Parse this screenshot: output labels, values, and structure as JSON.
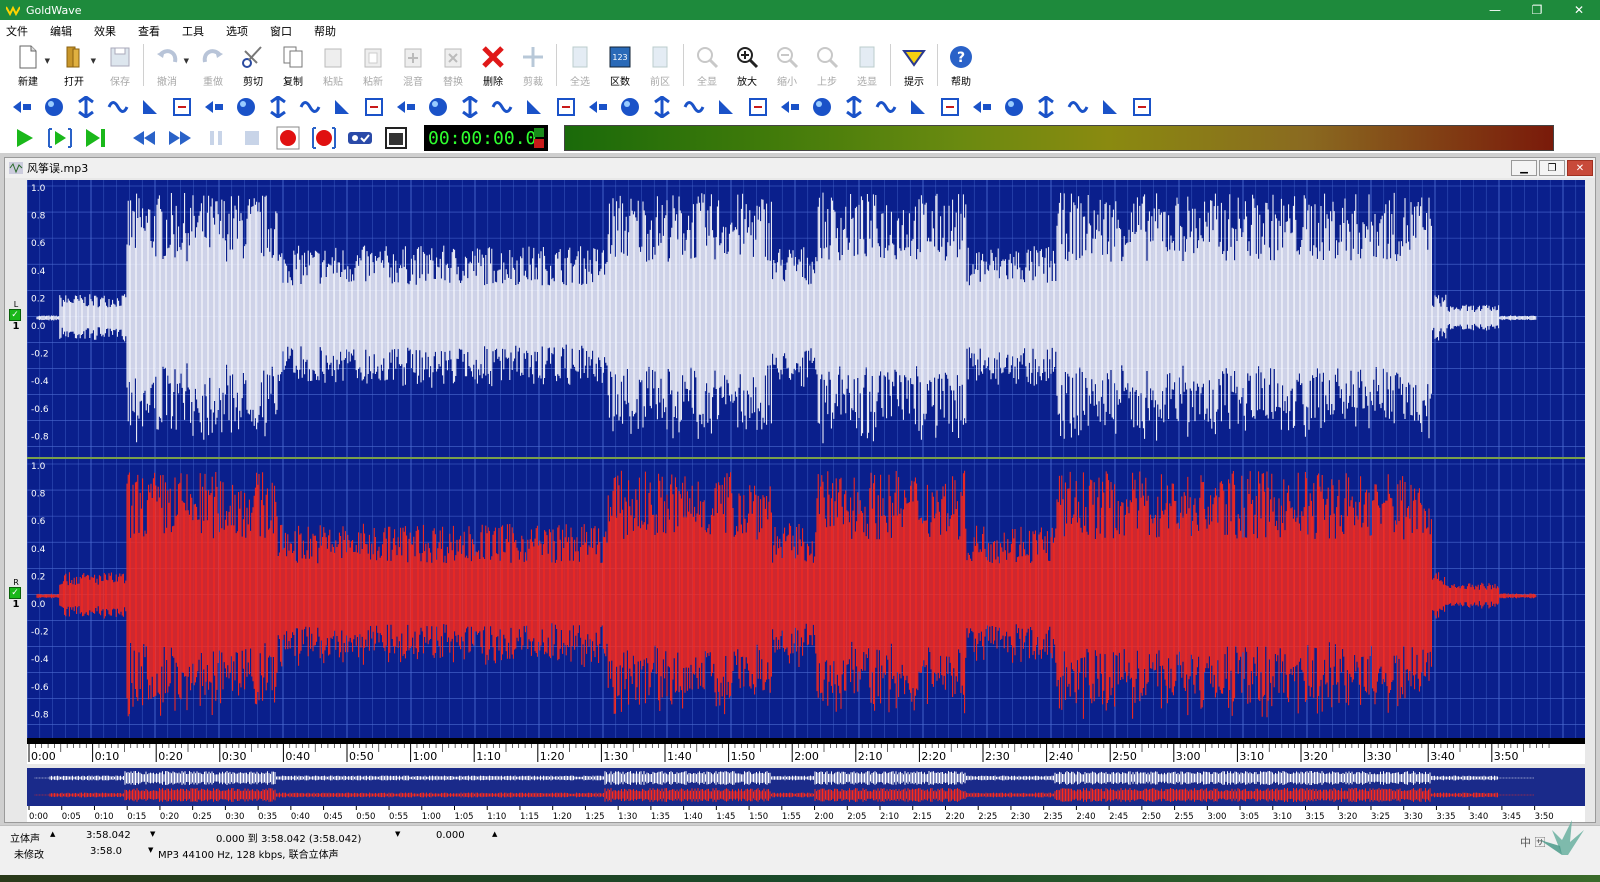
{
  "app": {
    "title": "GoldWave",
    "window_controls": {
      "minimize": "—",
      "maximize": "❐",
      "close": "✕"
    }
  },
  "menu": [
    "文件",
    "编辑",
    "效果",
    "查看",
    "工具",
    "选项",
    "窗口",
    "帮助"
  ],
  "toolbar": [
    {
      "label": "新建",
      "icon": "new-file-icon",
      "dropdown": true,
      "enabled": true
    },
    {
      "label": "打开",
      "icon": "open-icon",
      "dropdown": true,
      "enabled": true
    },
    {
      "label": "保存",
      "icon": "save-icon",
      "enabled": false
    },
    {
      "label": "撤消",
      "icon": "undo-icon",
      "dropdown": true,
      "enabled": false
    },
    {
      "label": "重做",
      "icon": "redo-icon",
      "enabled": false
    },
    {
      "label": "剪切",
      "icon": "scissors-icon",
      "enabled": true
    },
    {
      "label": "复制",
      "icon": "copy-icon",
      "enabled": true
    },
    {
      "label": "粘贴",
      "icon": "paste-icon",
      "enabled": false
    },
    {
      "label": "粘新",
      "icon": "paste-new-icon",
      "enabled": false
    },
    {
      "label": "混音",
      "icon": "mix-icon",
      "enabled": false
    },
    {
      "label": "替换",
      "icon": "replace-icon",
      "enabled": false
    },
    {
      "label": "删除",
      "icon": "delete-icon",
      "enabled": true
    },
    {
      "label": "剪裁",
      "icon": "trim-icon",
      "enabled": false
    },
    {
      "label": "全选",
      "icon": "select-all-icon",
      "enabled": false
    },
    {
      "label": "区数",
      "icon": "region-count-icon",
      "enabled": true
    },
    {
      "label": "前区",
      "icon": "prev-region-icon",
      "enabled": false
    },
    {
      "label": "全显",
      "icon": "show-all-icon",
      "enabled": false
    },
    {
      "label": "放大",
      "icon": "zoom-in-icon",
      "enabled": true
    },
    {
      "label": "缩小",
      "icon": "zoom-out-icon",
      "enabled": false
    },
    {
      "label": "上步",
      "icon": "previous-step-icon",
      "enabled": false
    },
    {
      "label": "选显",
      "icon": "show-selection-icon",
      "enabled": false
    },
    {
      "label": "提示",
      "icon": "cue-icon",
      "enabled": true
    },
    {
      "label": "帮助",
      "icon": "help-icon",
      "enabled": true
    }
  ],
  "effects_toolbar": [
    "volume-icon",
    "invert-icon",
    "flip-icon",
    "globe-icon",
    "crossfade-icon",
    "merge-icon",
    "wave-icon",
    "loop-icon",
    "filter-icon",
    "palette-icon",
    "equalizer-icon",
    "swap-icon",
    "left-arrow-icon",
    "balance-icon",
    "mixer-icon",
    "level-icon",
    "compressor-icon",
    "spectrum-icon",
    "pitch-icon",
    "noise-icon",
    "spectrum-bar-icon",
    "fade-in-icon",
    "offset-icon",
    "volume-shape-icon",
    "fade-out-icon",
    "fade-in-shape-icon",
    "fade-out-shape-icon",
    "volume-up-icon",
    "volume-down-icon",
    "tag-icon",
    "no-icon",
    "shape-a-icon",
    "shape-b-icon",
    "shape-c-icon",
    "clock-icon",
    "chat-icon"
  ],
  "transport": {
    "time": "00:00:00.0",
    "buttons": [
      "play-icon",
      "play-selection-icon",
      "play-to-end-icon",
      "rewind-icon",
      "fast-forward-icon",
      "pause-icon",
      "stop-icon",
      "record-icon",
      "record-new-icon",
      "control-icon",
      "properties-icon"
    ]
  },
  "document": {
    "filename": "风筝误.mp3",
    "channels": [
      "L",
      "R"
    ],
    "scale_labels": [
      "1.0",
      "0.8",
      "0.6",
      "0.4",
      "0.2",
      "0.0",
      "-0.2",
      "-0.4",
      "-0.6",
      "-0.8"
    ],
    "colors": {
      "background": "#0a1f8c",
      "grid": "#4a6ad0",
      "left_wave": "#ffffff",
      "right_wave": "#ff2a1a",
      "divider": "#7aa04a"
    },
    "timeline_labels": [
      "0:00",
      "0:10",
      "0:20",
      "0:30",
      "0:40",
      "0:50",
      "1:00",
      "1:10",
      "1:20",
      "1:30",
      "1:40",
      "1:50",
      "2:00",
      "2:10",
      "2:20",
      "2:30",
      "2:40",
      "2:50",
      "3:00",
      "3:10",
      "3:20",
      "3:30",
      "3:40",
      "3:50"
    ],
    "overview_labels": [
      "0:00",
      "0:05",
      "0:10",
      "0:15",
      "0:20",
      "0:25",
      "0:30",
      "0:35",
      "0:40",
      "0:45",
      "0:50",
      "0:55",
      "1:00",
      "1:05",
      "1:10",
      "1:15",
      "1:20",
      "1:25",
      "1:30",
      "1:35",
      "1:40",
      "1:45",
      "1:50",
      "1:55",
      "2:00",
      "2:05",
      "2:10",
      "2:15",
      "2:20",
      "2:25",
      "2:30",
      "2:35",
      "2:40",
      "2:45",
      "2:50",
      "2:55",
      "3:00",
      "3:05",
      "3:10",
      "3:15",
      "3:20",
      "3:25",
      "3:30",
      "3:35",
      "3:40",
      "3:45",
      "3:50"
    ]
  },
  "status": {
    "channel_mode": "立体声",
    "length": "3:58.042",
    "selection": "0.000 到 3:58.042 (3:58.042)",
    "position": "0.000",
    "modified": "未修改",
    "length2": "3:58.0",
    "format": "MP3 44100 Hz, 128 kbps, 联合立体声"
  },
  "ime": "中 🈂"
}
